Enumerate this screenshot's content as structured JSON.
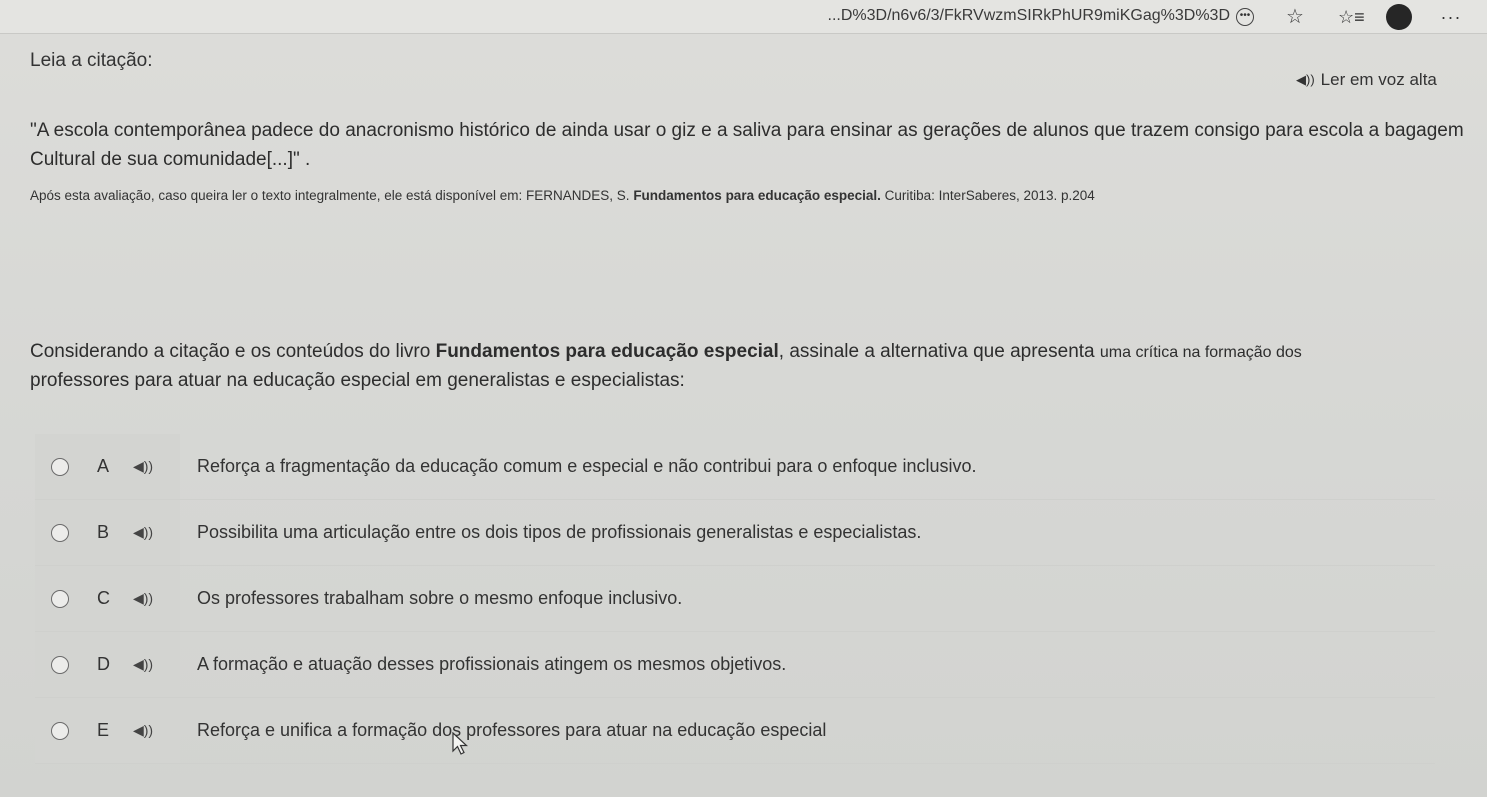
{
  "browser": {
    "url": "...D%3D/n6v6/3/FkRVwzmSIRkPhUR9miKGag%3D%3D"
  },
  "header": {
    "label": "Leia a citação:",
    "tts_label": "Ler em voz alta"
  },
  "quote": {
    "text": "\"A escola contemporânea padece do anacronismo histórico de ainda usar o giz e a saliva para ensinar as gerações de alunos que trazem consigo para escola a bagagem Cultural de sua comunidade[...]\" ."
  },
  "source": {
    "prefix": "Após esta avaliação, caso queira ler o texto integralmente, ele está disponível em: FERNANDES, S. ",
    "book": "Fundamentos para educação especial.",
    "suffix": " Curitiba: InterSaberes, 2013. p.204"
  },
  "question": {
    "prefix": "Considerando a citação e os conteúdos do livro ",
    "book": "Fundamentos para educação especial",
    "middle": ", assinale a alternativa que apresenta ",
    "small": "uma crítica na formação dos",
    "rest": "professores para atuar na educação especial em generalistas e especialistas:"
  },
  "options": [
    {
      "letter": "A",
      "text": "Reforça a fragmentação da educação comum e especial e não contribui para o enfoque inclusivo."
    },
    {
      "letter": "B",
      "text": "Possibilita uma articulação entre os dois tipos de profissionais generalistas e especialistas."
    },
    {
      "letter": "C",
      "text": "Os professores  trabalham sobre o mesmo enfoque inclusivo."
    },
    {
      "letter": "D",
      "text": "A formação e atuação desses profissionais atingem os mesmos objetivos."
    },
    {
      "letter": "E",
      "text": "Reforça e unifica a formação dos professores para atuar na educação especial"
    }
  ],
  "icons": {
    "speaker": "speaker-icon",
    "reading_mode": "reading-mode-icon",
    "favorite": "star-icon",
    "collections": "favorites-list-icon",
    "profile": "profile-icon",
    "more": "more-icon",
    "cursor": "mouse-cursor-icon"
  }
}
